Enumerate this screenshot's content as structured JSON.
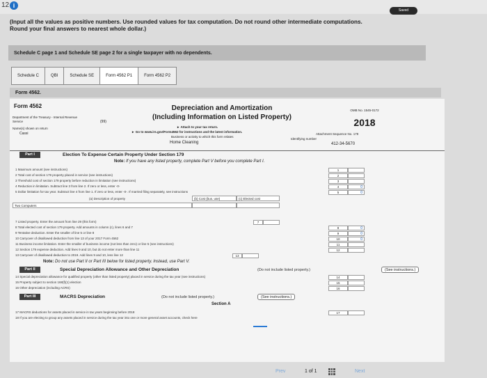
{
  "top": {
    "question_number": "12",
    "saved_label": "Saved"
  },
  "instructions": "(Input all the values as positive numbers. Use rounded values for tax computation. Do not round other intermediate computations. Round your final answers to nearest whole dollar.)",
  "problem_banner": "Schedule C page 1 and Schedule SE page 2 for a single taxpayer with no dependents.",
  "tabs": [
    {
      "label": "Schedule C",
      "active": false
    },
    {
      "label": "QBI",
      "active": false
    },
    {
      "label": "Schedule SE",
      "active": false
    },
    {
      "label": "Form 4562 P1",
      "active": true
    },
    {
      "label": "Form 4562 P2",
      "active": false
    }
  ],
  "form_label": "Form 4562.",
  "form": {
    "name": "Form 4562",
    "dept_line1": "Department of the Treasury - Internal Revenue",
    "dept_line2": "Service",
    "dept_code": "(99)",
    "names_label": "Name(s) shown on return",
    "name_value": "Cassi",
    "title_line1": "Depreciation and Amortization",
    "title_line2": "(Including Information on Listed Property)",
    "attach": "► Attach to your tax return.",
    "goto": "► Go to www.irs.gov/Form4562 for instructions and the latest information.",
    "business_label": "Business or activity to which this form relates",
    "business_value": "Home Cleaning",
    "omb": "OMB No. 1545-0172",
    "year": "2018",
    "attachment": "Attachment Sequence No. 179",
    "id_label": "Identifying number",
    "id_value": "412-34-5670"
  },
  "part1": {
    "label": "Part I",
    "title": "Election To Expense Certain Property Under Section 179",
    "note_bold": "Note:",
    "note_text": "If you have any listed property, complete Part V before you complete Part I.",
    "lines": [
      {
        "text": "1   Maximum amount (see instructions)",
        "num": "1",
        "value": ""
      },
      {
        "text": "2   Total cost of section 179 property placed in service (see instructions)",
        "num": "2",
        "value": ""
      },
      {
        "text": "3   Threshold cost of section 179 property before reduction in limitation (see instructions)",
        "num": "3",
        "value": ""
      },
      {
        "text": "4   Reduction in limitation. Subtract line 3 from line 2. If zero or less, enter -0-",
        "num": "4",
        "value": "0"
      },
      {
        "text": "5   Dollar limitation for tax year. Subtract line 4 from line 1. If zero or less, enter -0-. If married filing separately, see instructions",
        "num": "5",
        "value": "0"
      }
    ],
    "col_a": "(a) Description of property",
    "col_b": "(b) Cost (bus. use)",
    "col_c": "(c) Elected cost",
    "row6": "Two Computers",
    "lines_b": [
      {
        "text": "7   Listed property. Enter the amount from line 29 (this form)",
        "num": "7",
        "value": ""
      },
      {
        "text": "8   Total elected cost of section 179 property. Add amounts in column (c), lines 6 and 7",
        "num": "8",
        "value": "0"
      },
      {
        "text": "9   Tentative deduction. Enter the smaller of line 5 or line 8",
        "num": "9",
        "value": "0"
      },
      {
        "text": "10  Carryover of disallowed deduction from line 13 of your 2017 Form 4562",
        "num": "10",
        "value": "0"
      },
      {
        "text": "11  Business income limitation. Enter the smaller of business income (not less than zero) or line 5 (see instructions)",
        "num": "11",
        "value": ""
      },
      {
        "text": "12  Section 179 expense deduction. Add lines 9 and 10, but do not enter more than line 11",
        "num": "12",
        "value": ""
      },
      {
        "text": "13  Carryover of disallowed deduction to 2019. Add lines 9 and 10, less line 12",
        "num": "13",
        "value": ""
      }
    ],
    "note2_bold": "Note:",
    "note2_text": "Do not use Part II or Part III below for listed property. Instead, use Part V."
  },
  "part2": {
    "label": "Part II",
    "title": "Special Depreciation Allowance and Other Depreciation",
    "not_include": "(Do not include listed property.)",
    "see": "(See instructions.)",
    "lines": [
      {
        "text": "14  Special depreciation allowance for qualified property (other than listed property) placed in service during the tax year (see instructions)",
        "num": "14"
      },
      {
        "text": "15  Property subject to section 168(f)(1) election",
        "num": "15"
      },
      {
        "text": "16  Other depreciation (including ACRS)",
        "num": "16"
      }
    ]
  },
  "part3": {
    "label": "Part III",
    "title": "MACRS Depreciation",
    "not_include": "(Do not include listed property.)",
    "see": "(See instructions.)",
    "section": "Section A",
    "lines": [
      {
        "text": "17  MACRS deductions for assets placed in service in tax years beginning before 2018",
        "num": "17"
      },
      {
        "text": "18  If you are electing to group any assets placed in service during the tax year into one or more general asset accounts, check here",
        "num": ""
      }
    ]
  },
  "pager": {
    "prev": "Prev",
    "position": "1 of 1",
    "next": "Next"
  }
}
